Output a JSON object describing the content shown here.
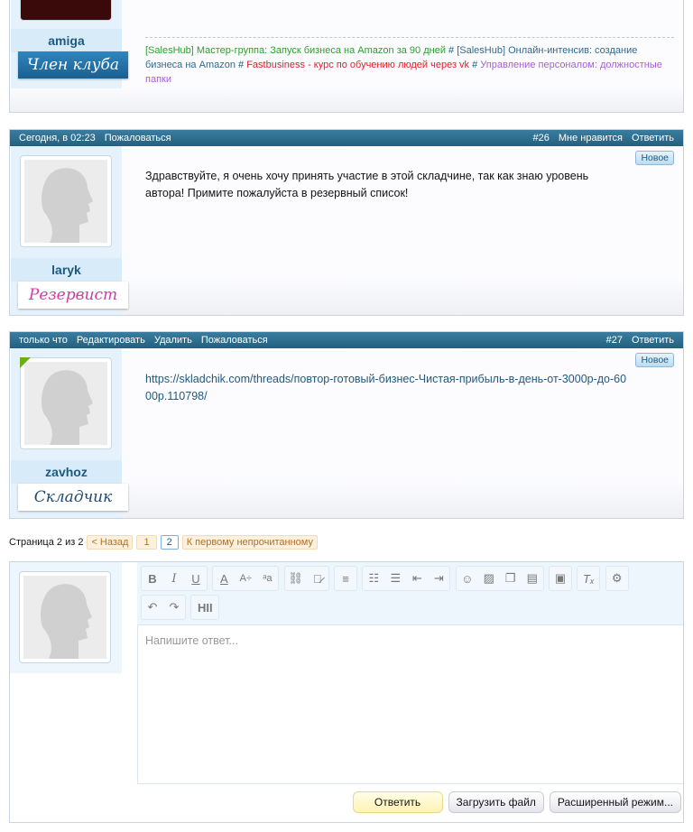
{
  "post_top": {
    "username": "amiga",
    "role": "Член клуба",
    "signature": [
      {
        "text": "[SalesHub] Мастер-группа: Запуск бизнеса на Amazon за 90 дней",
        "color": "#2ca02c"
      },
      {
        "text": " # ",
        "color": "#1e5a80"
      },
      {
        "text": "[SalesHub] Онлайн-интенсив: создание бизнеса на Amazon",
        "color": "#2f6a8f"
      },
      {
        "text": " # ",
        "color": "#1e5a80"
      },
      {
        "text": "Fastbusiness - курс по обучению людей через vk",
        "color": "#e0202a"
      },
      {
        "text": " # ",
        "color": "#1e5a80"
      },
      {
        "text": "Управление персоналом: должностные папки",
        "color": "#a860d8"
      }
    ]
  },
  "posts": [
    {
      "meta": [
        "Сегодня, в 02:23",
        "Пожаловаться"
      ],
      "actions": [
        "#26",
        "Мне нравится",
        "Ответить"
      ],
      "username": "laryk",
      "role": "Резервист",
      "badge": "Новое",
      "text": "Здравствуйте, я очень хочу принять участие в этой складчине, так как знаю уровень автора! Примите пожалуйста в резервный список!"
    },
    {
      "meta": [
        "только что",
        "Редактировать",
        "Удалить",
        "Пожаловаться"
      ],
      "actions": [
        "#27",
        "Ответить"
      ],
      "username": "zavhoz",
      "role": "Складчик",
      "badge": "Новое",
      "text": "https://skladchik.com/threads/повтор-готовый-бизнес-Чистая-прибыль-в-день-от-3000р-до-6000р.110798/"
    }
  ],
  "pagination": {
    "label": "Страница 2 из 2",
    "prev": "< Назад",
    "pages": [
      "1",
      "2"
    ],
    "first_unread": "К первому непрочитанному"
  },
  "editor": {
    "placeholder": "Напишите ответ...",
    "reply": "Ответить",
    "upload": "Загрузить файл",
    "advanced": "Расширенный режим..."
  }
}
